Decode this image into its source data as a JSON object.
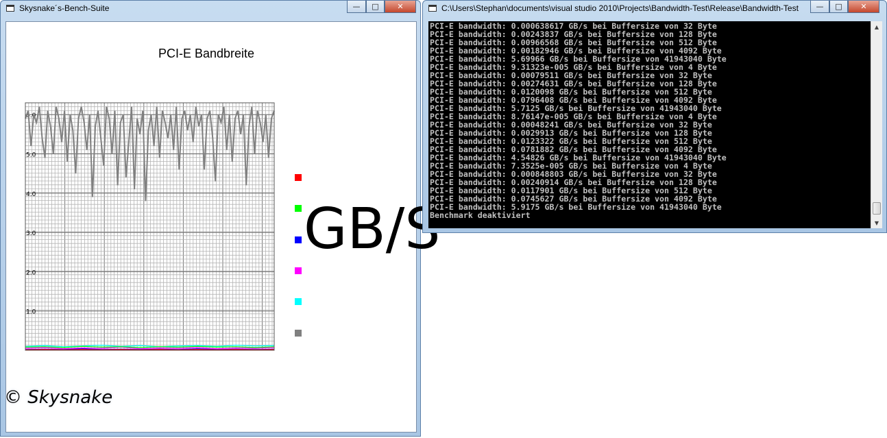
{
  "left_window": {
    "title": "Skysnake´s-Bench-Suite",
    "minimize": "—",
    "maximize": "□",
    "close": "✕",
    "chart_heading": "PCI-E Bandbreite",
    "unit_label": "GB/S",
    "signature": "© Skysnake",
    "legend_colors": [
      "#ff0000",
      "#00ff00",
      "#0000ff",
      "#ff00ff",
      "#00ffff",
      "#808080"
    ]
  },
  "chart_data": {
    "type": "line",
    "title": "PCI-E Bandbreite",
    "ylabel": "GB/S",
    "ylim": [
      0,
      6.3
    ],
    "y_ticks": [
      "6.0",
      "5.0",
      "4.0",
      "3.0",
      "2.0",
      "1.0"
    ],
    "grid": true,
    "legend_position": "right",
    "series": [
      {
        "color": "#808080",
        "values": [
          5.9,
          6.1,
          5.2,
          6.0,
          5.8,
          6.2,
          5.4,
          4.9,
          6.1,
          5.7,
          5.0,
          6.2,
          5.9,
          5.3,
          6.1,
          4.8,
          6.0,
          5.6,
          4.5,
          5.9,
          6.2,
          5.8,
          5.1,
          6.0,
          3.9,
          5.7,
          6.1,
          5.4,
          4.7,
          6.2,
          5.9,
          5.0,
          6.1,
          4.2,
          5.8,
          6.0,
          4.4,
          5.3,
          6.2,
          4.1,
          5.9,
          5.5,
          6.1,
          3.8,
          5.6,
          6.0,
          5.2,
          6.2,
          4.9,
          6.1,
          5.8,
          5.4,
          6.0,
          5.1,
          6.2,
          4.6,
          5.9,
          6.1,
          5.6,
          6.0,
          5.3,
          6.2,
          5.7,
          6.0,
          4.6,
          5.9,
          6.1,
          5.4,
          4.3,
          6.0,
          5.8,
          6.2,
          5.1,
          6.0,
          4.8,
          5.9,
          6.1,
          5.5,
          6.0,
          4.2,
          5.7,
          6.2,
          5.0,
          6.1,
          5.8,
          5.3,
          6.0,
          4.9,
          5.9,
          6.1
        ]
      },
      {
        "color": "#ff00ff",
        "values": [
          0.05,
          0.07,
          0.04,
          0.06,
          0.05,
          0.08,
          0.04,
          0.06,
          0.05,
          0.07,
          0.04,
          0.06,
          0.05,
          0.07
        ]
      },
      {
        "color": "#0000ff",
        "values": [
          0.02,
          0.03,
          0.02,
          0.04,
          0.02,
          0.03,
          0.02,
          0.03,
          0.02,
          0.04,
          0.02,
          0.03,
          0.02,
          0.03
        ]
      },
      {
        "color": "#00ffff",
        "values": [
          0.1,
          0.12,
          0.09,
          0.11,
          0.13,
          0.1,
          0.12,
          0.09,
          0.11,
          0.12,
          0.1,
          0.13,
          0.11,
          0.12
        ]
      },
      {
        "color": "#00ff00",
        "values": [
          0.08,
          0.09,
          0.07,
          0.1,
          0.08,
          0.09,
          0.07,
          0.09,
          0.08,
          0.1,
          0.08,
          0.09,
          0.07,
          0.09
        ]
      },
      {
        "color": "#ff0000",
        "values": [
          0.01,
          0.02,
          0.01,
          0.02,
          0.01,
          0.02,
          0.01,
          0.02,
          0.01,
          0.02,
          0.01,
          0.02,
          0.01,
          0.02
        ]
      }
    ]
  },
  "console_window": {
    "title": "C:\\Users\\Stephan\\documents\\visual studio 2010\\Projects\\Bandwidth-Test\\Release\\Bandwidth-Test...",
    "minimize": "—",
    "maximize": "□",
    "close": "✕",
    "lines": [
      "PCI-E bandwidth: 0.000638617 GB/s bei Buffersize von 32 Byte",
      "PCI-E bandwidth: 0.00243837 GB/s bei Buffersize von 128 Byte",
      "PCI-E bandwidth: 0.00966568 GB/s bei Buffersize von 512 Byte",
      "PCI-E bandwidth: 0.00182946 GB/s bei Buffersize von 4092 Byte",
      "PCI-E bandwidth: 5.69966 GB/s bei Buffersize von 41943040 Byte",
      "PCI-E bandwidth: 9.31323e-005 GB/s bei Buffersize von 4 Byte",
      "PCI-E bandwidth: 0.00079511 GB/s bei Buffersize von 32 Byte",
      "PCI-E bandwidth: 0.00274631 GB/s bei Buffersize von 128 Byte",
      "PCI-E bandwidth: 0.0120098 GB/s bei Buffersize von 512 Byte",
      "PCI-E bandwidth: 0.0796408 GB/s bei Buffersize von 4092 Byte",
      "PCI-E bandwidth: 5.7125 GB/s bei Buffersize von 41943040 Byte",
      "PCI-E bandwidth: 8.76147e-005 GB/s bei Buffersize von 4 Byte",
      "PCI-E bandwidth: 0.00048241 GB/s bei Buffersize von 32 Byte",
      "PCI-E bandwidth: 0.0029913 GB/s bei Buffersize von 128 Byte",
      "PCI-E bandwidth: 0.0123322 GB/s bei Buffersize von 512 Byte",
      "PCI-E bandwidth: 0.0781882 GB/s bei Buffersize von 4092 Byte",
      "PCI-E bandwidth: 4.54826 GB/s bei Buffersize von 41943040 Byte",
      "PCI-E bandwidth: 7.3525e-005 GB/s bei Buffersize von 4 Byte",
      "PCI-E bandwidth: 0.000848803 GB/s bei Buffersize von 32 Byte",
      "PCI-E bandwidth: 0.00240914 GB/s bei Buffersize von 128 Byte",
      "PCI-E bandwidth: 0.0117901 GB/s bei Buffersize von 512 Byte",
      "PCI-E bandwidth: 0.0745627 GB/s bei Buffersize von 4092 Byte",
      "PCI-E bandwidth: 5.9175 GB/s bei Buffersize von 41943040 Byte",
      "Benchmark deaktiviert"
    ],
    "scroll_up_icon": "▲",
    "scroll_down_icon": "▼"
  }
}
